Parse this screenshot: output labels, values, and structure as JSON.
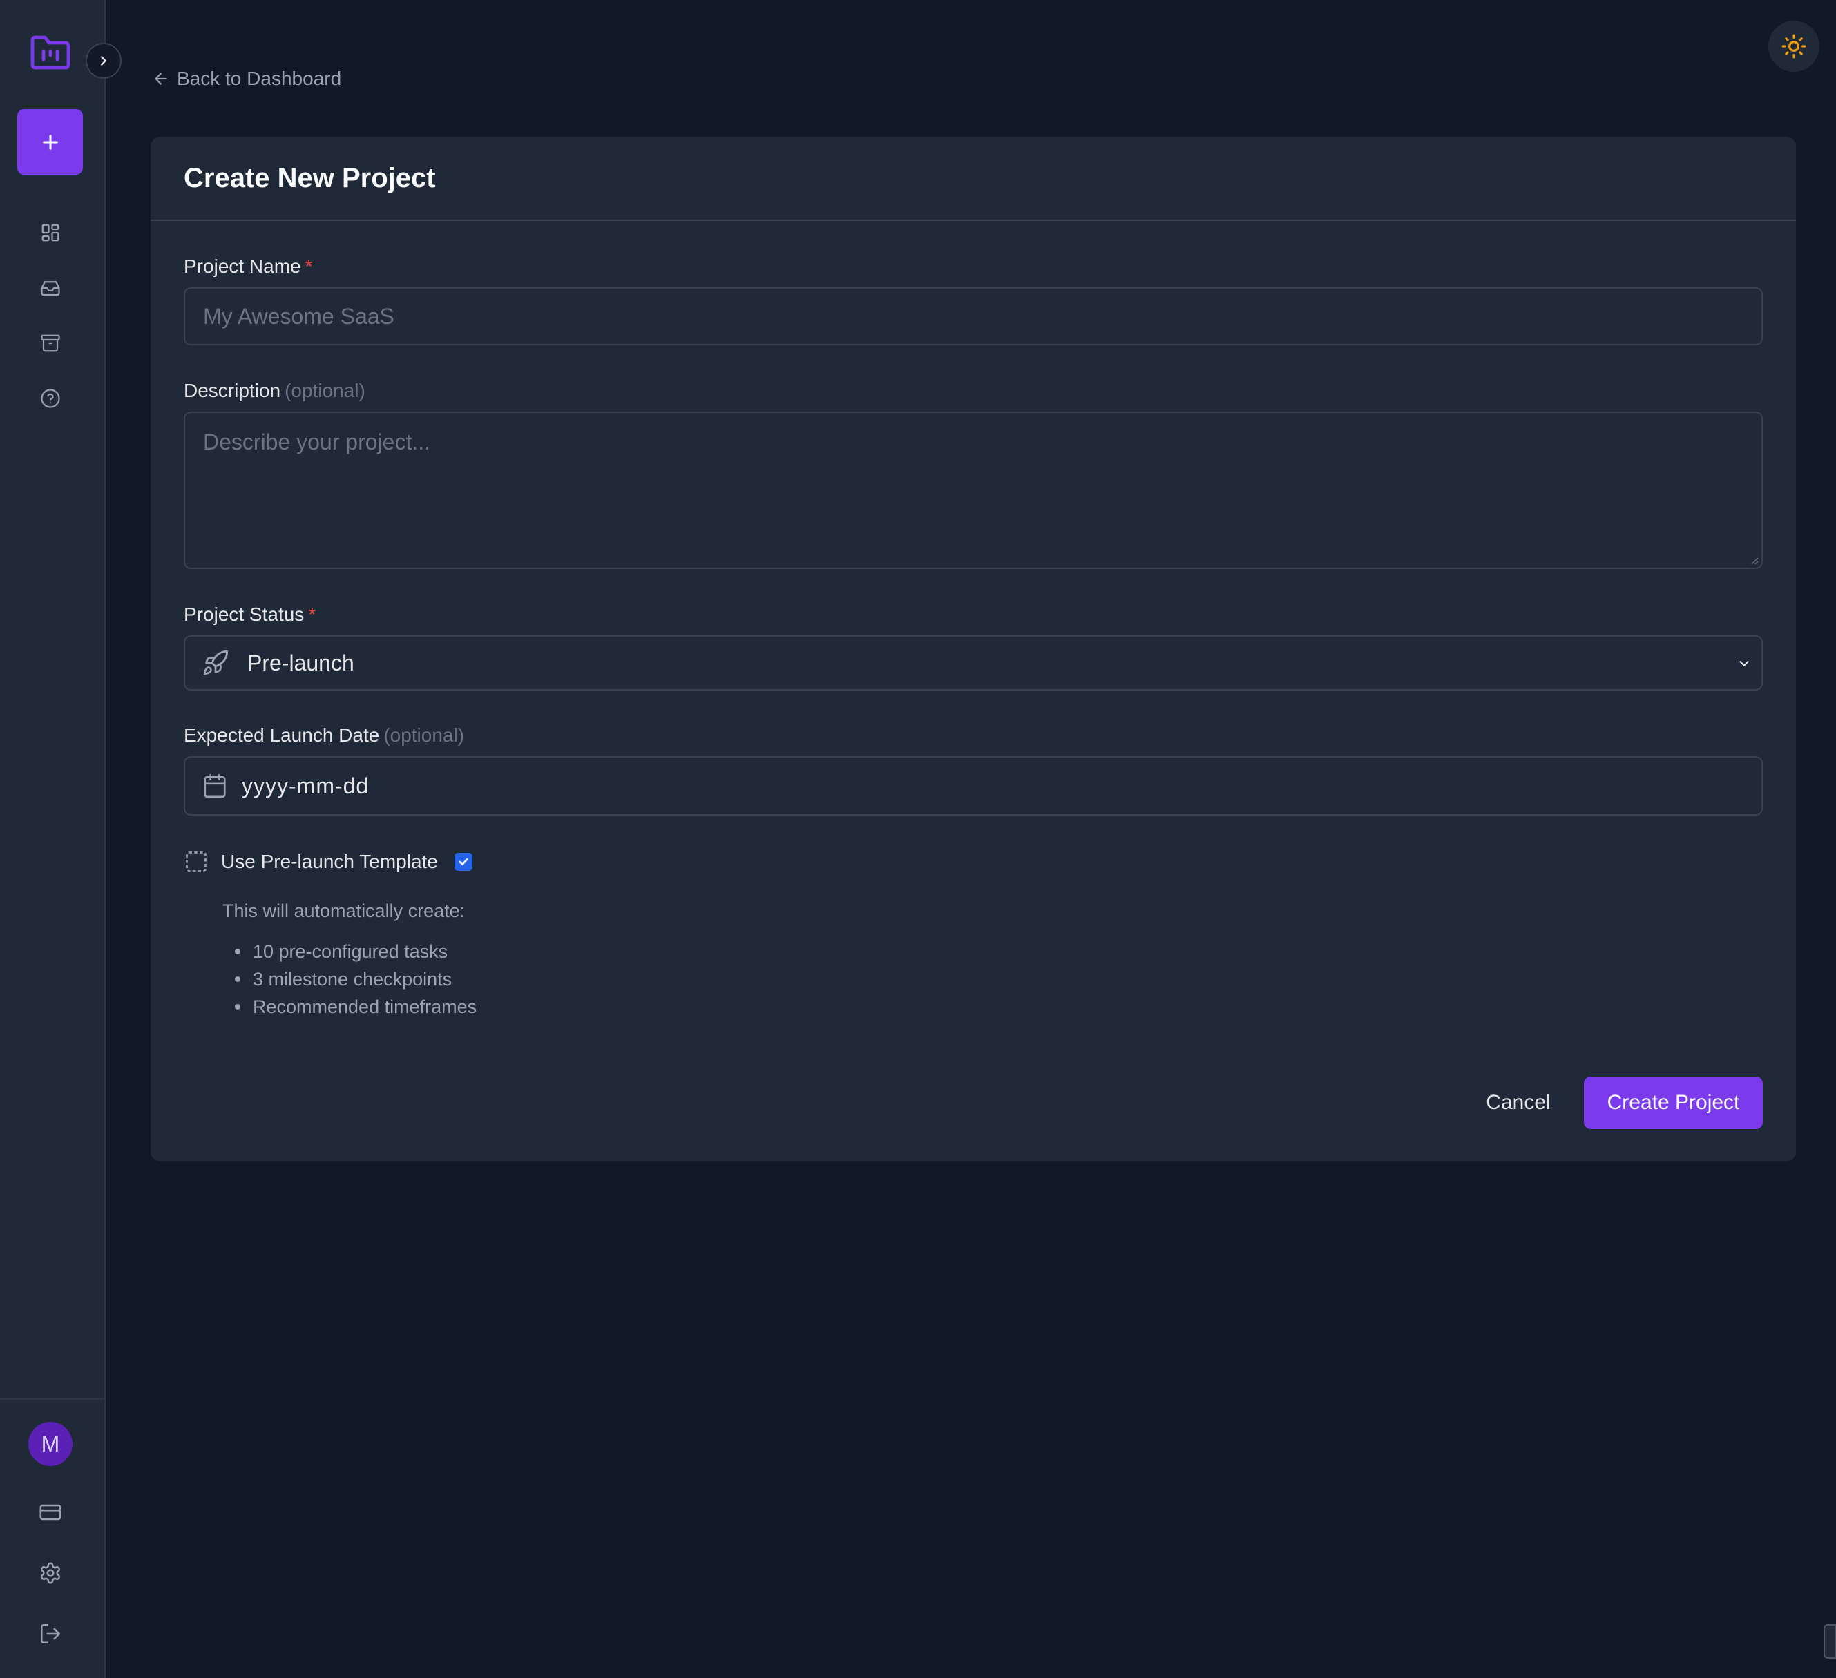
{
  "sidebar": {
    "logo_icon": "folder-kanban-icon",
    "expand_icon": "chevron-right-icon",
    "new_button": {
      "label": "+",
      "icon": "plus-icon"
    },
    "nav_items": [
      {
        "name": "dashboard",
        "icon": "grid-icon"
      },
      {
        "name": "inbox",
        "icon": "inbox-icon"
      },
      {
        "name": "archive",
        "icon": "archive-icon"
      },
      {
        "name": "help",
        "icon": "help-circle-icon"
      }
    ],
    "user": {
      "avatar_initial": "M"
    },
    "bottom_items": [
      {
        "name": "billing",
        "icon": "credit-card-icon"
      },
      {
        "name": "settings",
        "icon": "gear-icon"
      },
      {
        "name": "logout",
        "icon": "logout-icon"
      }
    ]
  },
  "header": {
    "theme_toggle_icon": "sun-icon"
  },
  "back_link": {
    "label": "Back to Dashboard"
  },
  "form": {
    "title": "Create New Project",
    "project_name": {
      "label": "Project Name",
      "required_mark": "*",
      "placeholder": "My Awesome SaaS",
      "value": ""
    },
    "description": {
      "label": "Description",
      "optional_note": "(optional)",
      "placeholder": "Describe your project...",
      "value": ""
    },
    "project_status": {
      "label": "Project Status",
      "required_mark": "*",
      "selected": "Pre-launch",
      "icon": "rocket-icon"
    },
    "launch_date": {
      "label": "Expected Launch Date",
      "optional_note": "(optional)",
      "placeholder": "yyyy-mm-dd",
      "icon": "calendar-icon"
    },
    "template": {
      "label": "Use Pre-launch Template",
      "checked": true,
      "icon": "dashed-square-icon",
      "note": "This will automatically create:",
      "items": [
        "10 pre-configured tasks",
        "3 milestone checkpoints",
        "Recommended timeframes"
      ]
    },
    "cancel_label": "Cancel",
    "submit_label": "Create Project"
  },
  "colors": {
    "page_bg": "#111827",
    "panel_bg": "#1f2937",
    "accent": "#7c3aed",
    "required": "#ef4444",
    "sun": "#f59e0b"
  }
}
